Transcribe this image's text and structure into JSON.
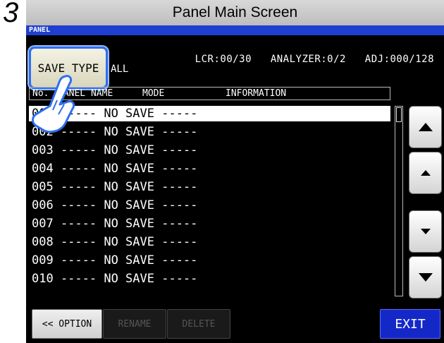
{
  "step_number": "3",
  "window_title": "Panel Main Screen",
  "panel_label": "PANEL",
  "save_type_button": "SAVE TYPE",
  "save_type_value": "ALL",
  "counters": {
    "lcr": "LCR:00/30",
    "analyzer": "ANALYZER:0/2",
    "adj": "ADJ:000/128"
  },
  "columns": {
    "no": "No.",
    "panel_name": "PANEL NAME",
    "mode": "MODE",
    "information": "INFORMATION"
  },
  "rows": [
    {
      "text": "001 ----- NO SAVE -----"
    },
    {
      "text": "002 ----- NO SAVE -----"
    },
    {
      "text": "003 ----- NO SAVE -----"
    },
    {
      "text": "004 ----- NO SAVE -----"
    },
    {
      "text": "005 ----- NO SAVE -----"
    },
    {
      "text": "006 ----- NO SAVE -----"
    },
    {
      "text": "007 ----- NO SAVE -----"
    },
    {
      "text": "008 ----- NO SAVE -----"
    },
    {
      "text": "009 ----- NO SAVE -----"
    },
    {
      "text": "010 ----- NO SAVE -----"
    }
  ],
  "selected_row_index": 0,
  "scroll_buttons": [
    "page-up-icon",
    "line-up-icon",
    "line-down-icon",
    "page-down-icon"
  ],
  "buttons": {
    "option": "<< OPTION",
    "rename": "RENAME",
    "delete": "DELETE",
    "exit": "EXIT"
  },
  "colors": {
    "screen_bg": "#000000",
    "panel_strip": "#1f3fd0",
    "exit_bg": "#1428c8",
    "highlight": "#2f6ff0"
  }
}
